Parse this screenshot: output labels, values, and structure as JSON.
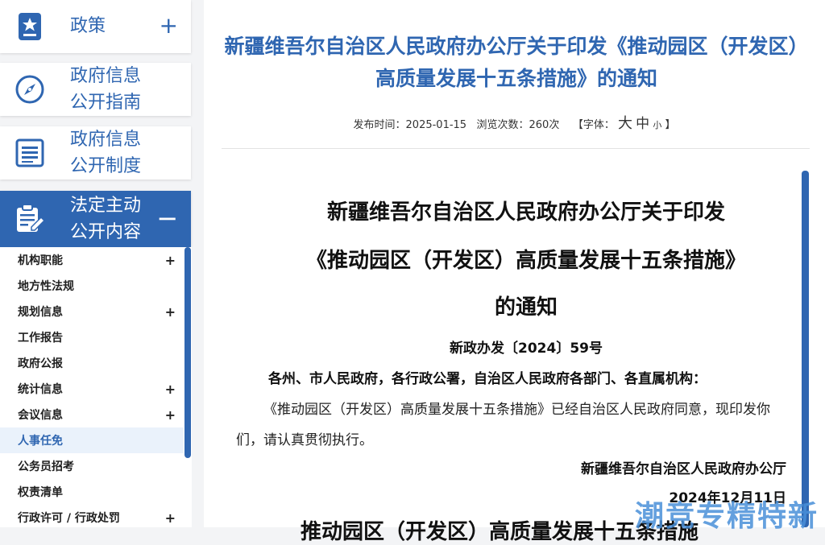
{
  "sidebar": {
    "nav": [
      {
        "label": "政策",
        "icon": "star-document-icon",
        "toggle": "+"
      },
      {
        "label": "政府信息公开指南",
        "icon": "compass-icon"
      },
      {
        "label": "政府信息公开制度",
        "icon": "list-document-icon"
      },
      {
        "label": "法定主动公开内容",
        "icon": "edit-document-icon",
        "toggle": "−"
      }
    ],
    "submenu": [
      {
        "label": "机构职能",
        "plus": "+"
      },
      {
        "label": "地方性法规"
      },
      {
        "label": "规划信息",
        "plus": "+"
      },
      {
        "label": "工作报告"
      },
      {
        "label": "政府公报"
      },
      {
        "label": "统计信息",
        "plus": "+"
      },
      {
        "label": "会议信息",
        "plus": "+"
      },
      {
        "label": "人事任免"
      },
      {
        "label": "公务员招考"
      },
      {
        "label": "权责清单"
      },
      {
        "label": "行政许可 / 行政处罚",
        "plus": "+"
      }
    ]
  },
  "article": {
    "title": "新疆维吾尔自治区人民政府办公厅关于印发《推动园区（开发区）高质量发展十五条措施》的通知",
    "meta": {
      "date_label": "发布时间：",
      "date": "2025-01-15",
      "views_label": "浏览次数：",
      "views": "260次",
      "font_open": "【字体：",
      "font_big": "大",
      "font_mid": "中",
      "font_small": "小",
      "font_close": "】"
    },
    "doc_title_lines": [
      "新疆维吾尔自治区人民政府办公厅关于印发",
      "《推动园区（开发区）高质量发展十五条措施》",
      "的通知"
    ],
    "doc_no": "新政办发〔2024〕59号",
    "addressee": "各州、市人民政府，各行政公署，自治区人民政府各部门、各直属机构：",
    "body": "《推动园区（开发区）高质量发展十五条措施》已经自治区人民政府同意，现印发你们，请认真贯彻执行。",
    "signer": "新疆维吾尔自治区人民政府办公厅",
    "sign_date": "2024年12月11日",
    "next_heading": "推动园区（开发区）高质量发展十五条措施"
  },
  "watermark": "潮竞专精特新",
  "colors": {
    "accent": "#2f66b1"
  }
}
